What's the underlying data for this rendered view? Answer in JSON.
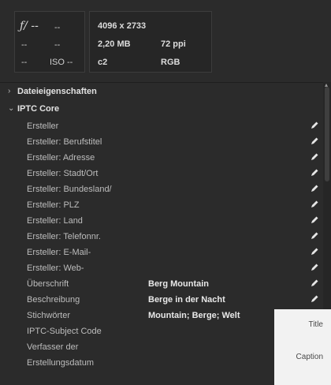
{
  "camera": {
    "fstop": "ƒ/ --",
    "exposure": "--",
    "row2_a": "--",
    "row2_b": "--",
    "row3_a": "--",
    "iso": "ISO --"
  },
  "file": {
    "dimensions": "4096 x 2733",
    "size": "2,20 MB",
    "resolution": "72 ppi",
    "color_label": "c2",
    "color_mode": "RGB"
  },
  "sections": {
    "file_props": "Dateieigenschaften",
    "iptc_core": "IPTC Core"
  },
  "rows": [
    {
      "key": "Ersteller",
      "value": ""
    },
    {
      "key": "Ersteller: Berufstitel",
      "value": ""
    },
    {
      "key": "Ersteller: Adresse",
      "value": ""
    },
    {
      "key": "Ersteller: Stadt/Ort",
      "value": ""
    },
    {
      "key": "Ersteller: Bundesland/",
      "value": ""
    },
    {
      "key": "Ersteller: PLZ",
      "value": ""
    },
    {
      "key": "Ersteller: Land",
      "value": ""
    },
    {
      "key": "Ersteller: Telefonnr.",
      "value": ""
    },
    {
      "key": "Ersteller: E-Mail-",
      "value": ""
    },
    {
      "key": "Ersteller: Web-",
      "value": ""
    },
    {
      "key": "Überschrift",
      "value": "Berg Mountain"
    },
    {
      "key": "Beschreibung",
      "value": "Berge in der Nacht"
    },
    {
      "key": "Stichwörter",
      "value": "Mountain; Berge; Welt"
    },
    {
      "key": "IPTC-Subject Code",
      "value": ""
    },
    {
      "key": "Verfasser der",
      "value": ""
    },
    {
      "key": "Erstellungsdatum",
      "value": ""
    }
  ],
  "overlay": {
    "title": "Title",
    "caption": "Caption"
  }
}
